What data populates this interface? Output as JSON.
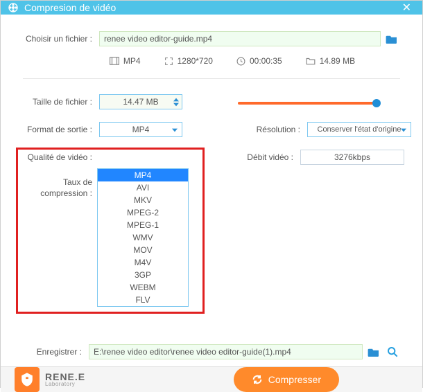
{
  "window": {
    "title": "Compresion de vidéo"
  },
  "file": {
    "choose_label": "Choisir un fichier :",
    "filename": "renee video editor-guide.mp4"
  },
  "meta": {
    "format": "MP4",
    "dimensions": "1280*720",
    "duration": "00:00:35",
    "size": "14.89 MB"
  },
  "fields": {
    "size_label": "Taille de fichier :",
    "size_value": "14.47 MB",
    "format_label": "Format de sortie :",
    "format_value": "MP4",
    "format_options": [
      "MP4",
      "AVI",
      "MKV",
      "MPEG-2",
      "MPEG-1",
      "WMV",
      "MOV",
      "M4V",
      "3GP",
      "WEBM",
      "FLV"
    ],
    "resolution_label": "Résolution :",
    "resolution_value": "Conserver l'état d'origine",
    "quality_label": "Qualité de vidéo :",
    "bitrate_label": "Débit vidéo :",
    "bitrate_value": "3276kbps",
    "compression_label_line1": "Taux de",
    "compression_label_line2": "compression :"
  },
  "save": {
    "label": "Enregistrer :",
    "path": "E:\\renee video editor\\renee video editor-guide(1).mp4"
  },
  "logo": {
    "main": "RENE.E",
    "sub": "Laboratory"
  },
  "buttons": {
    "compress": "Compresser"
  },
  "colors": {
    "accent": "#4fc3e8",
    "primary_button": "#ff8a2b",
    "highlight_red": "#e02020"
  }
}
